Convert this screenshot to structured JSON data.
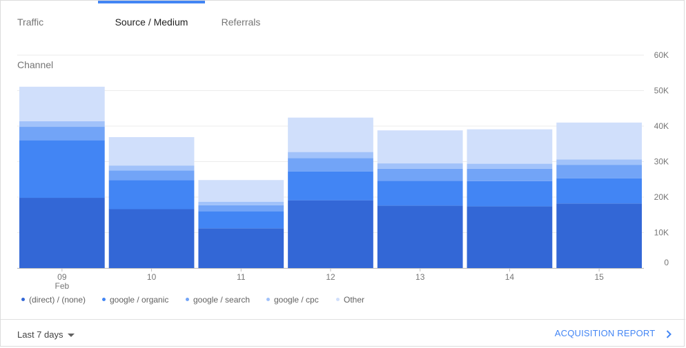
{
  "tabs": [
    {
      "label": "Traffic Channel"
    },
    {
      "label": "Source / Medium"
    },
    {
      "label": "Referrals"
    }
  ],
  "active_tab": 1,
  "chart_data": {
    "type": "bar",
    "stacked": true,
    "categories": [
      "09",
      "10",
      "11",
      "12",
      "13",
      "14",
      "15"
    ],
    "category_sublabels": [
      "Feb",
      "",
      "",
      "",
      "",
      "",
      ""
    ],
    "series": [
      {
        "name": "(direct) / (none)",
        "color": "#3367d6",
        "values": [
          19800,
          16600,
          11200,
          19100,
          17600,
          17400,
          18200
        ]
      },
      {
        "name": "google / organic",
        "color": "#4285f4",
        "values": [
          16200,
          8200,
          4800,
          8100,
          7000,
          7100,
          7100
        ]
      },
      {
        "name": "google / search",
        "color": "#72a4f7",
        "values": [
          3800,
          2700,
          1700,
          3800,
          3400,
          3500,
          3800
        ]
      },
      {
        "name": "google / cpc",
        "color": "#a1c2fa",
        "values": [
          1600,
          1400,
          1000,
          1700,
          1500,
          1400,
          1500
        ]
      },
      {
        "name": "Other",
        "color": "#d0dffb",
        "values": [
          9700,
          8000,
          6100,
          9700,
          9300,
          9700,
          10400
        ]
      }
    ],
    "y_ticks": [
      "0",
      "10K",
      "20K",
      "30K",
      "40K",
      "50K",
      "60K"
    ],
    "ylim": [
      0,
      60000
    ],
    "grid": true,
    "y_axis_position": "right",
    "legend_position": "bottom"
  },
  "footer": {
    "date_range": "Last 7 days",
    "report_link": "ACQUISITION REPORT"
  }
}
